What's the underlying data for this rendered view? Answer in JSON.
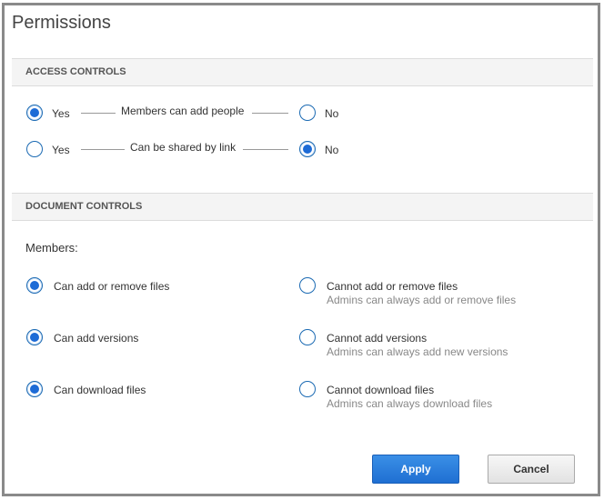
{
  "dialog": {
    "title": "Permissions"
  },
  "access_controls": {
    "header": "ACCESS CONTROLS",
    "rows": [
      {
        "yes_label": "Yes",
        "center_label": "Members can add people",
        "no_label": "No",
        "selected": "yes"
      },
      {
        "yes_label": "Yes",
        "center_label": "Can be shared by link",
        "no_label": "No",
        "selected": "no"
      }
    ]
  },
  "document_controls": {
    "header": "DOCUMENT CONTROLS",
    "members_label": "Members:",
    "rows": [
      {
        "allow_label": "Can add or remove files",
        "deny_label": "Cannot add or remove files",
        "deny_note": "Admins can always add or remove files",
        "selected": "allow"
      },
      {
        "allow_label": "Can add versions",
        "deny_label": "Cannot add versions",
        "deny_note": "Admins can always add new versions",
        "selected": "allow"
      },
      {
        "allow_label": "Can download files",
        "deny_label": "Cannot download files",
        "deny_note": "Admins can always download files",
        "selected": "allow"
      }
    ]
  },
  "buttons": {
    "apply_label": "Apply",
    "cancel_label": "Cancel"
  },
  "colors": {
    "accent": "#1d6bd6",
    "primary_button": "#2a7fe0",
    "section_bg": "#f4f4f4"
  }
}
